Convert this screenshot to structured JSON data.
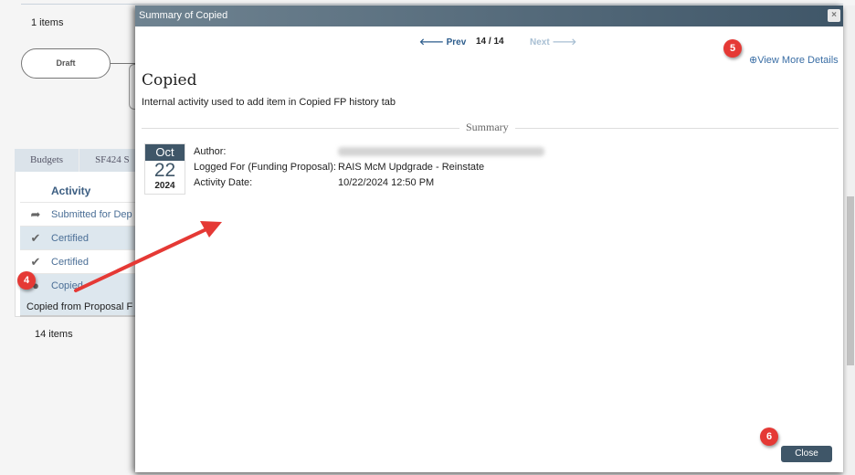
{
  "background": {
    "items_top": "1 items",
    "draft": "Draft",
    "tabs": [
      "Budgets",
      "SF424 S"
    ],
    "activity_header": "Activity",
    "rows": [
      {
        "icon": "share-arrow-icon",
        "label": "Submitted for Dep"
      },
      {
        "icon": "check-icon",
        "label": "Certified"
      },
      {
        "icon": "check-icon",
        "label": "Certified"
      },
      {
        "icon": "copy-icon",
        "label": "Copied"
      }
    ],
    "copied_note": "Copied from Proposal F",
    "items_bottom": "14 items"
  },
  "modal": {
    "title": "Summary of Copied",
    "close_x": "×",
    "prev": "Prev",
    "counter": "14 / 14",
    "next": "Next",
    "view_more": "View More Details",
    "heading": "Copied",
    "description": "Internal activity used to add item in Copied FP history tab",
    "section": "Summary",
    "date": {
      "month": "Oct",
      "day": "22",
      "year": "2024"
    },
    "fields": {
      "author_label": "Author:",
      "logged_for_label": "Logged For (Funding Proposal):",
      "logged_for_value": "RAIS McM Updgrade - Reinstate",
      "date_label": "Activity Date:",
      "date_value": "10/22/2024 12:50 PM"
    },
    "close_button": "Close"
  },
  "annotations": {
    "badge4": "4",
    "badge5": "5",
    "badge6": "6",
    "arrow_color": "#e53935"
  }
}
